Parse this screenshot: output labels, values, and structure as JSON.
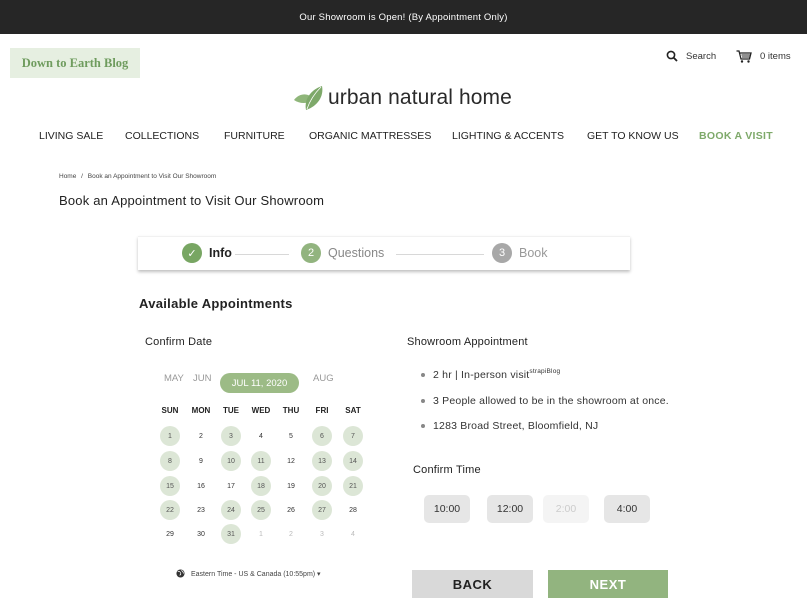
{
  "announcement": "Our Showroom is Open! (By Appointment Only)",
  "header": {
    "blog_button": "Down to Earth Blog",
    "search_label": "Search",
    "cart_label": "0 items",
    "logo_text": "urban natural home",
    "brand_color": "#7ea96a"
  },
  "nav": {
    "items": [
      "LIVING SALE",
      "COLLECTIONS",
      "FURNITURE",
      "ORGANIC MATTRESSES",
      "LIGHTING & ACCENTS",
      "GET TO KNOW US",
      "BOOK A VISIT"
    ]
  },
  "breadcrumb": {
    "home": "Home",
    "separator": "/",
    "current": "Book an Appointment to Visit Our Showroom"
  },
  "page_title": "Book an Appointment to Visit Our Showroom",
  "steps": [
    {
      "label": "Info",
      "marker": "✓",
      "state": "complete"
    },
    {
      "label": "Questions",
      "marker": "2",
      "state": "active"
    },
    {
      "label": "Book",
      "marker": "3",
      "state": "upcoming"
    }
  ],
  "section_title": "Available Appointments",
  "calendar": {
    "title": "Confirm Date",
    "months": [
      "MAY",
      "JUN",
      "JUL 11, 2020",
      "AUG"
    ],
    "selected_month": "JUL 11, 2020",
    "weekdays": [
      "SUN",
      "MON",
      "TUE",
      "WED",
      "THU",
      "FRI",
      "SAT"
    ],
    "weeks": [
      [
        "1",
        "2",
        "3",
        "4",
        "5",
        "6",
        "7"
      ],
      [
        "8",
        "9",
        "10",
        "11",
        "12",
        "13",
        "14"
      ],
      [
        "15",
        "16",
        "17",
        "18",
        "19",
        "20",
        "21"
      ],
      [
        "22",
        "23",
        "24",
        "25",
        "26",
        "27",
        "28"
      ],
      [
        "29",
        "30",
        "31",
        "1",
        "2",
        "3",
        "4"
      ]
    ],
    "available_days": [
      "1",
      "3",
      "6",
      "7",
      "8",
      "10",
      "11",
      "13",
      "14",
      "15",
      "18",
      "20",
      "21",
      "22",
      "24",
      "25",
      "27",
      "31"
    ],
    "timezone": "Eastern Time - US & Canada (10:55pm) ▾"
  },
  "appointment": {
    "title": "Showroom Appointment",
    "details": [
      "2 hr | In-person visit",
      "3 People allowed to be in the showroom at once.",
      "1283 Broad Street, Bloomfield, NJ"
    ],
    "details_suffix": "strapiBlog"
  },
  "time": {
    "title": "Confirm Time",
    "slots": [
      {
        "label": "10:00",
        "available": true
      },
      {
        "label": "12:00",
        "available": true
      },
      {
        "label": "2:00",
        "available": false
      },
      {
        "label": "4:00",
        "available": true
      }
    ]
  },
  "actions": {
    "back": "BACK",
    "next": "NEXT"
  }
}
